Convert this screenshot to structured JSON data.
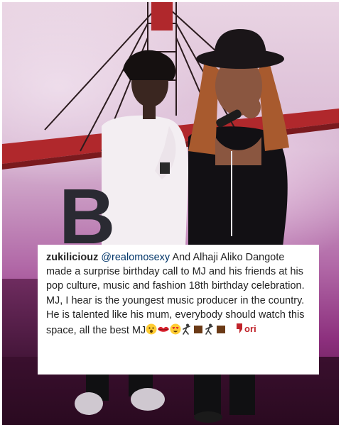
{
  "post": {
    "username": "zukiliciouz",
    "mention": "@realomosexy",
    "comment": "And Alhaji Aliko Dangote made a surprise birthday call to MJ and his friends at his pop culture, music and fashion 18th birthday celebration. MJ, I hear is the youngest music producer in the country. He is talented like his mum, everybody should watch this space, all the best MJ",
    "emojis": [
      "astonished-face-emoji",
      "kiss-lips-emoji",
      "heart-eyes-emoji",
      "dancer-emoji",
      "brown-square-emoji",
      "dancer-emoji",
      "brown-square-emoji"
    ]
  },
  "backdrop": {
    "letter": "B"
  },
  "watermark": {
    "logo_text": "ori"
  },
  "colors": {
    "caption_bg": "#ffffff",
    "username": "#262626",
    "mention": "#003569",
    "backdrop_red": "#b0282c",
    "stage_purple": "#8c2f7d"
  }
}
